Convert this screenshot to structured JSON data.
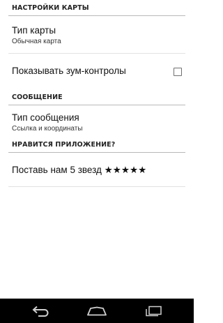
{
  "sections": {
    "map_settings": {
      "header": "НАСТРОЙКИ КАРТЫ",
      "map_type": {
        "title": "Тип карты",
        "summary": "Обычная карта"
      },
      "zoom_controls": {
        "title": "Показывать зум-контролы",
        "checked": false
      }
    },
    "message": {
      "header": "СООБЩЕНИЕ",
      "message_type": {
        "title": "Тип сообщения",
        "summary": "Ссылка и координаты"
      }
    },
    "like_app": {
      "header": "НРАВИТСЯ ПРИЛОЖЕНИЕ?",
      "rate": {
        "title": "Поставь нам 5 звезд ★★★★★"
      }
    }
  },
  "navigation_bar": {
    "icons": [
      "back-icon",
      "home-icon",
      "recent-apps-icon"
    ],
    "icon_color": "#cfcfcf",
    "background": "#000000"
  }
}
